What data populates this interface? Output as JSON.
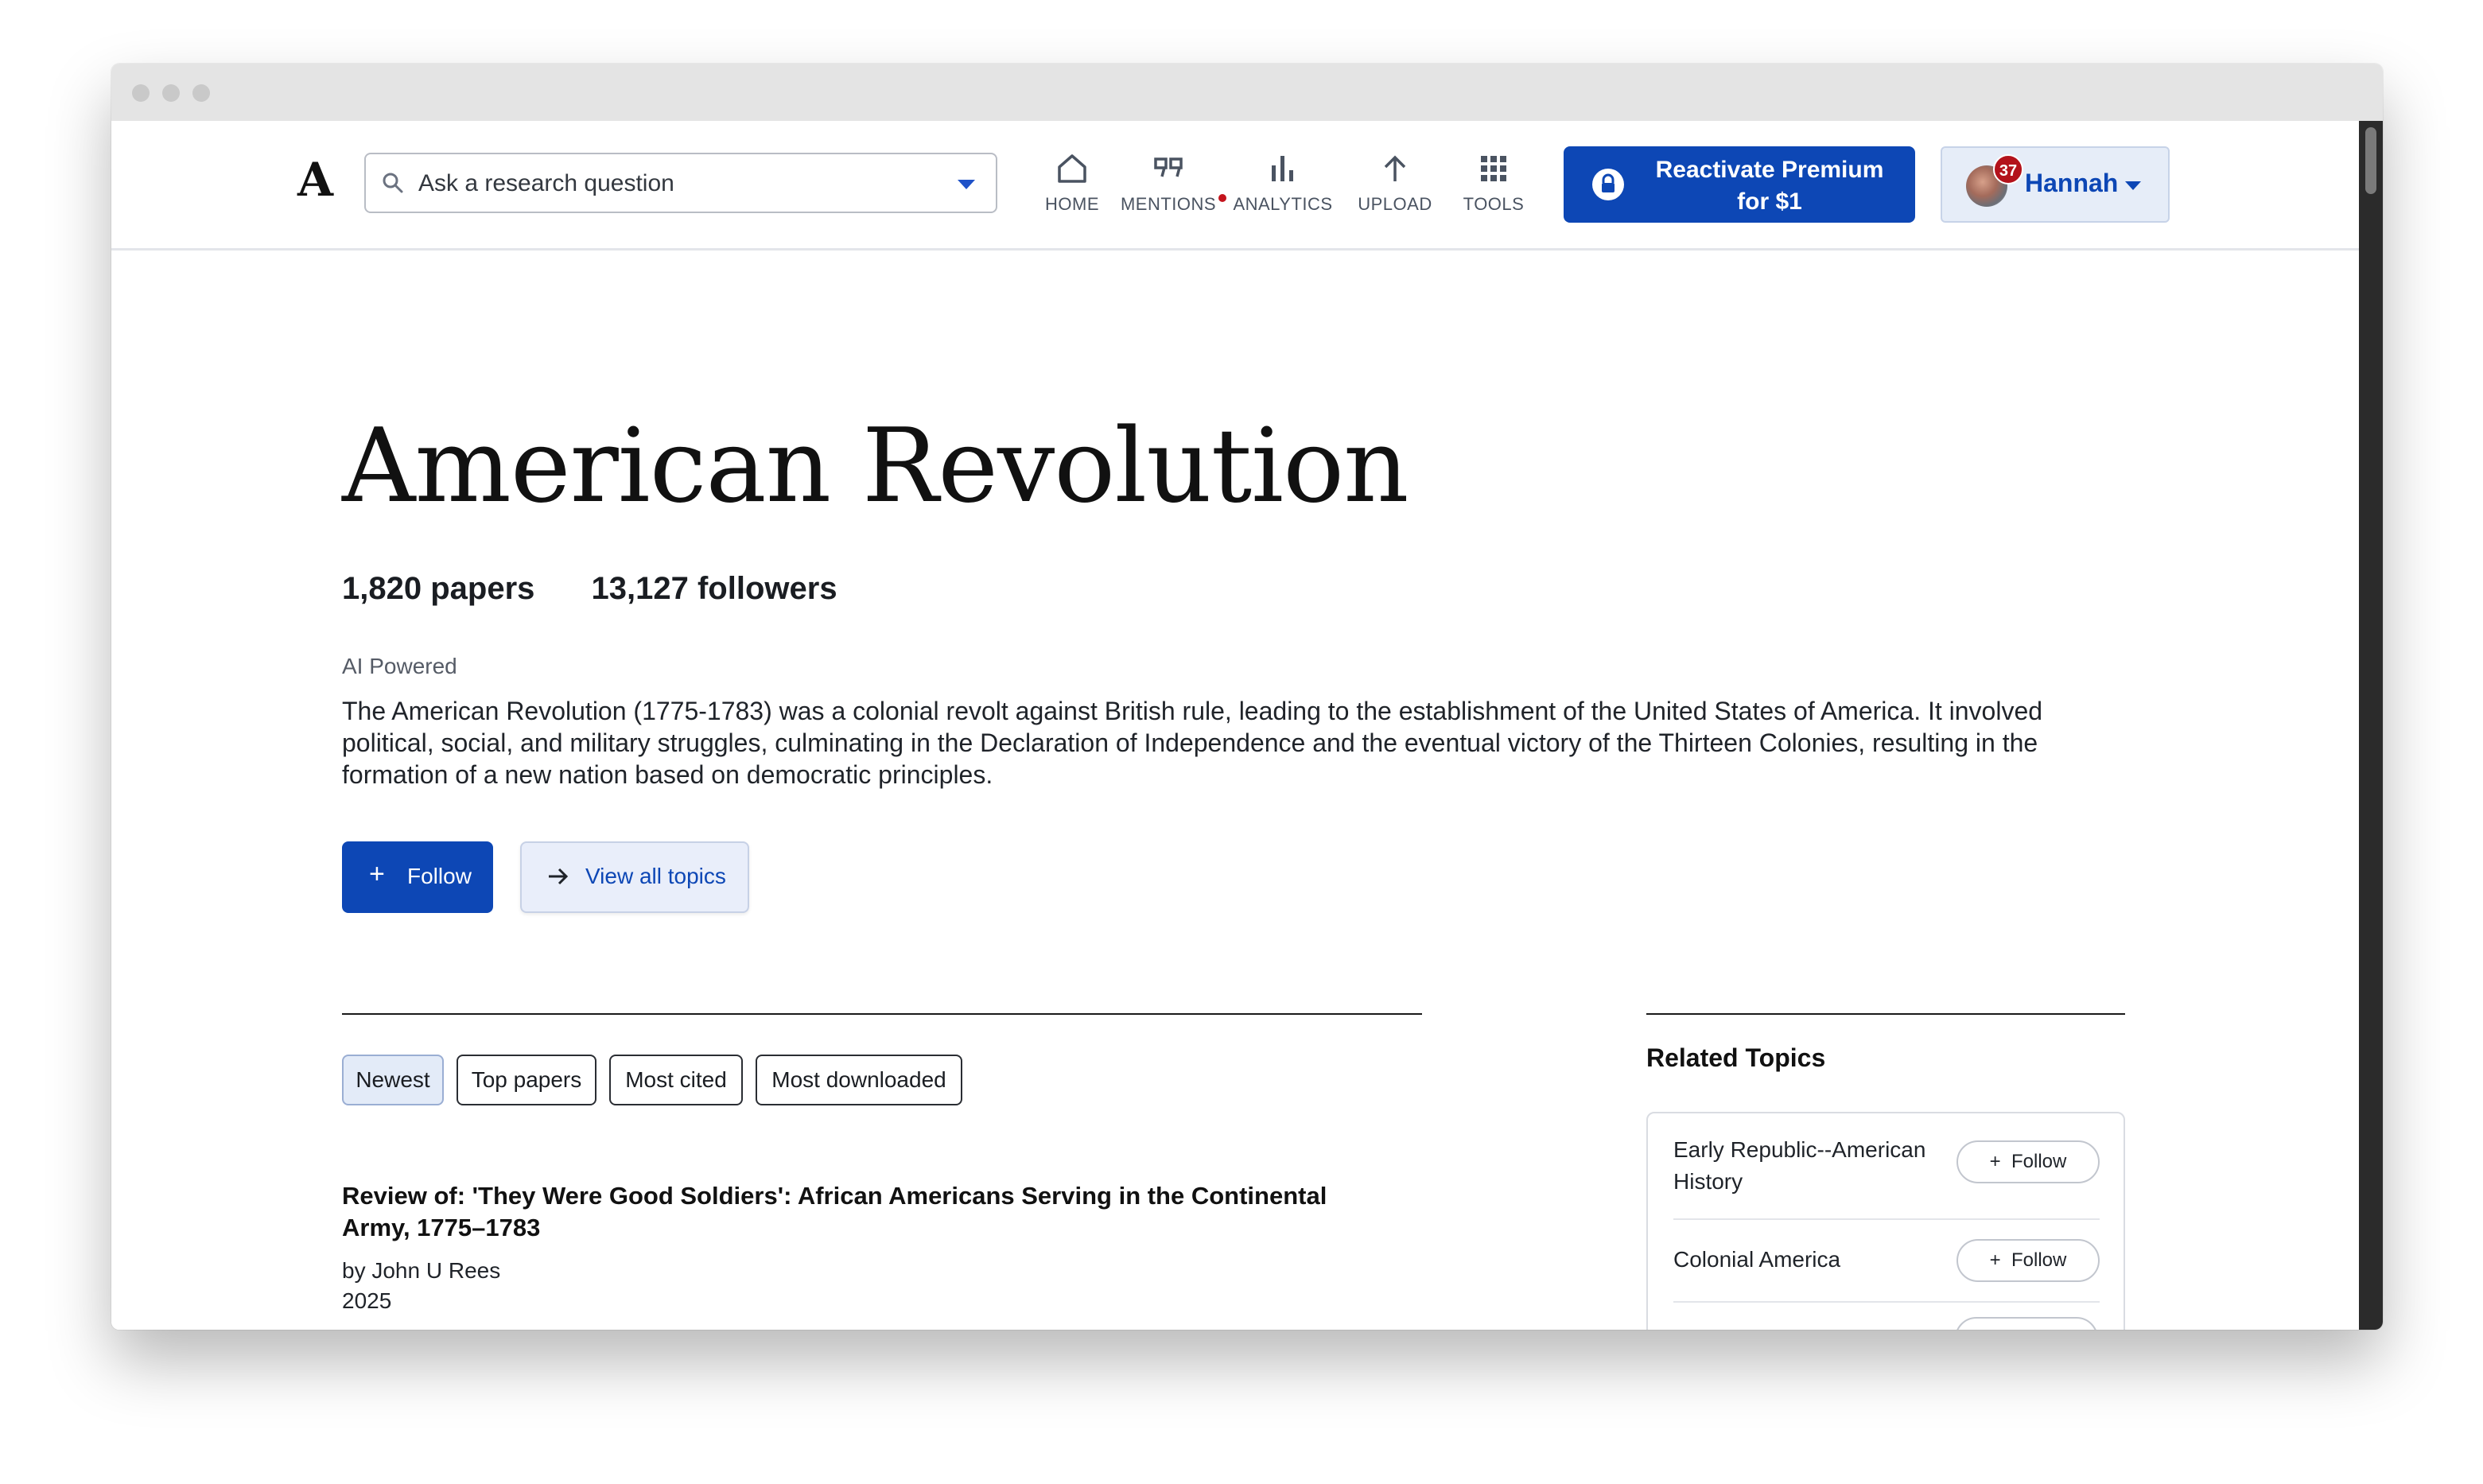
{
  "header": {
    "logo": "A",
    "search": {
      "placeholder": "Ask a research question"
    },
    "nav": [
      {
        "label": "HOME",
        "icon": "home-icon"
      },
      {
        "label": "MENTIONS",
        "icon": "quote-icon"
      },
      {
        "label": "ANALYTICS",
        "icon": "bar-chart-icon"
      },
      {
        "label": "UPLOAD",
        "icon": "upload-arrow-icon"
      },
      {
        "label": "TOOLS",
        "icon": "grid-icon"
      }
    ],
    "premium": {
      "line1": "Reactivate Premium",
      "line2": "for $1",
      "icon": "lock-icon"
    },
    "user": {
      "name": "Hannah",
      "notifications": "37"
    }
  },
  "topic": {
    "title": "American Revolution",
    "papers": "1,820 papers",
    "followers": "13,127 followers",
    "ai_label": "AI Powered",
    "description": "The American Revolution (1775-1783) was a colonial revolt against British rule, leading to the establishment of the United States of America. It involved political, social, and military struggles, culminating in the Declaration of Independence and the eventual victory of the Thirteen Colonies, resulting in the formation of a new nation based on democratic principles.",
    "follow_label": "Follow",
    "view_all_label": "View all topics"
  },
  "tabs": [
    "Newest",
    "Top papers",
    "Most cited",
    "Most downloaded"
  ],
  "active_tab": "Newest",
  "paper": {
    "title": "Review of: 'They Were Good Soldiers': African Americans Serving in the Continental Army, 1775–1783",
    "author": "by John U Rees",
    "year": "2025"
  },
  "related": {
    "heading": "Related Topics",
    "items": [
      {
        "name": "Early Republic--American History",
        "follow": "Follow"
      },
      {
        "name": "Colonial America",
        "follow": "Follow"
      }
    ]
  },
  "colors": {
    "brand_blue": "#0d47b5",
    "badge_red": "#b3121b",
    "active_tab_bg": "#e3ebf8"
  }
}
